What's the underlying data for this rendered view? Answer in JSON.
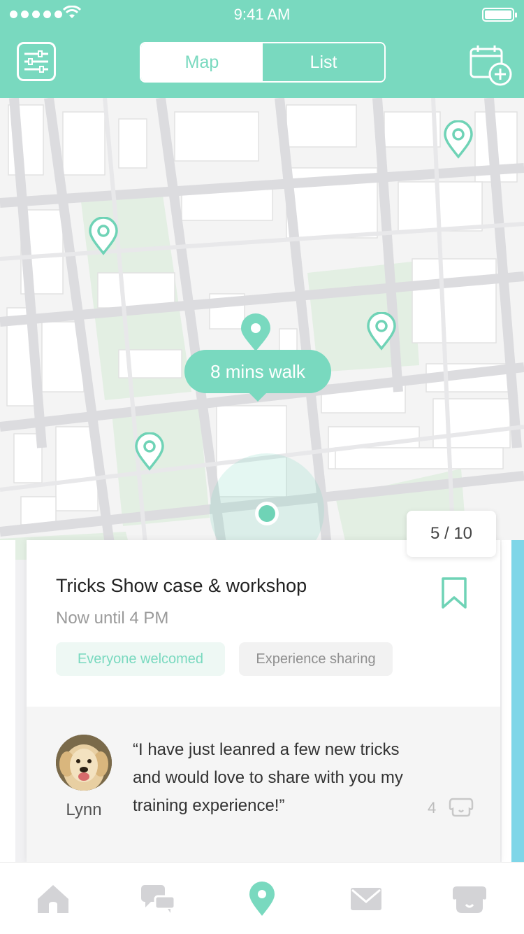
{
  "status_bar": {
    "time": "9:41 AM"
  },
  "header": {
    "segment": {
      "map_label": "Map",
      "list_label": "List",
      "selected": "Map"
    },
    "filter_icon": "sliders-icon",
    "calendar_icon": "calendar-add-icon"
  },
  "map": {
    "walk_bubble": "8 mins walk",
    "pins": [
      "location-pin-icon",
      "location-pin-icon",
      "location-pin-icon",
      "location-pin-icon",
      "location-pin-icon"
    ],
    "selected_pin": "location-pin-icon"
  },
  "pager": {
    "label": "5 / 10",
    "current": 5,
    "total": 10
  },
  "event": {
    "title": "Tricks Show case & workshop",
    "time": "Now until 4 PM",
    "tags": [
      "Everyone welcomed",
      "Experience sharing"
    ],
    "bookmark_icon": "bookmark-icon"
  },
  "comment": {
    "user": "Lynn",
    "text": "“I have just leanred a few new tricks and would love to share with you my training experience!”",
    "likes": "4",
    "like_icon": "dog-ear-icon"
  },
  "tabbar": {
    "items": [
      "home-icon",
      "chat-icon",
      "location-icon",
      "mail-icon",
      "dog-icon"
    ],
    "active": "location-icon"
  },
  "colors": {
    "accent": "#79d9bf",
    "water": "#7fd6e8",
    "park": "#e3efe3"
  }
}
